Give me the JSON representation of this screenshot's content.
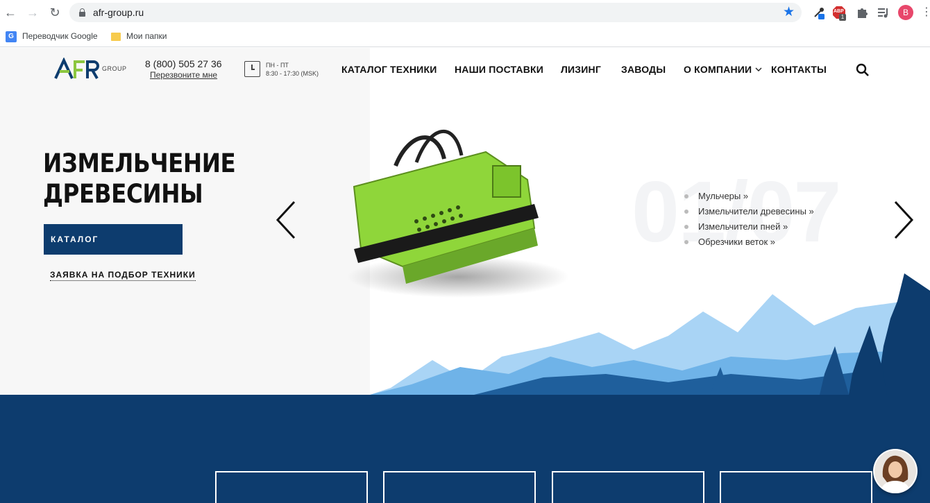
{
  "browser": {
    "url": "afr-group.ru",
    "profile_initial": "B",
    "extension_badge": "1",
    "abp_label": "ABP",
    "bookmarks": [
      {
        "label": "Переводчик Google",
        "icon": "google-translate-icon"
      },
      {
        "label": "Мои папки",
        "icon": "folder-icon"
      }
    ]
  },
  "header": {
    "logo_text": "AFR",
    "logo_sub": "GROUP",
    "phone": "8 (800) 505 27 36",
    "callback": "Перезвоните мне",
    "hours_days": "ПН - ПТ",
    "hours_time": "8:30 - 17:30 (MSK)",
    "menu": [
      {
        "label": "КАТАЛОГ ТЕХНИКИ"
      },
      {
        "label": "НАШИ ПОСТАВКИ"
      },
      {
        "label": "ЛИЗИНГ"
      },
      {
        "label": "ЗАВОДЫ"
      },
      {
        "label": "О КОМПАНИИ",
        "has_dropdown": true
      },
      {
        "label": "КОНТАКТЫ"
      }
    ]
  },
  "hero": {
    "title_line1": "ИЗМЕЛЬЧЕНИЕ",
    "title_line2": "ДРЕВЕСИНЫ",
    "catalog_button": "КАТАЛОГ",
    "request_link": "ЗАЯВКА НА ПОДБОР ТЕХНИКИ",
    "slide_counter": "01/07",
    "subcategories": [
      "Мульчеры »",
      "Измельчители древесины »",
      "Измельчители пней »",
      "Обрезчики веток »"
    ]
  },
  "colors": {
    "brand_navy": "#0d3c6e",
    "logo_green": "#8cc63f",
    "product_green": "#8fd63a",
    "mountain_light": "#a9d4f5",
    "mountain_mid": "#6fb3e8",
    "mountain_dark": "#1f5f9c"
  }
}
